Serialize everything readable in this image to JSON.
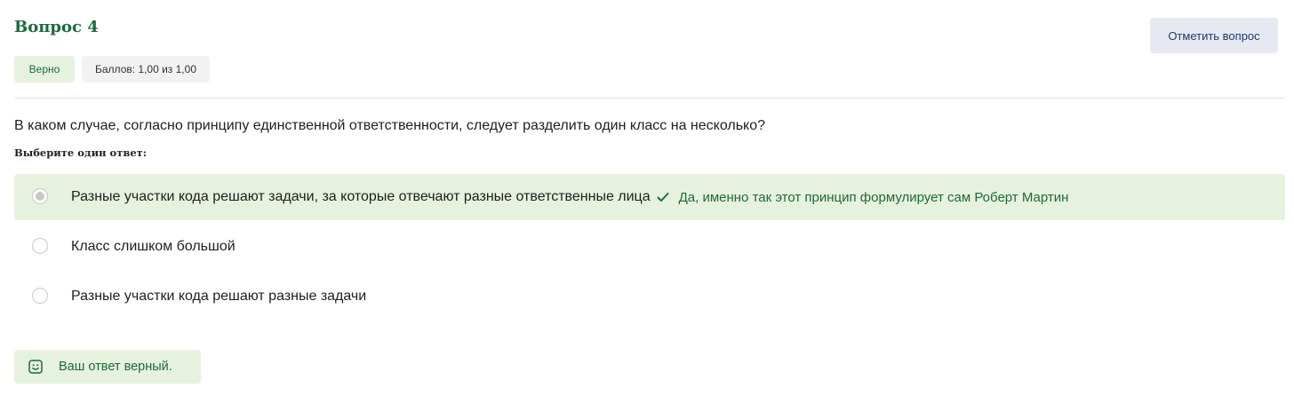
{
  "question": {
    "title": "Вопрос 4",
    "flag_label": "Отметить вопрос",
    "status_badge": "Верно",
    "score_badge": "Баллов: 1,00 из 1,00",
    "text": "В каком случае, согласно принципу единственной ответственности, следует разделить один класс на несколько?",
    "prompt": "Выберите один ответ:"
  },
  "options": [
    {
      "label": "Разные участки кода решают задачи, за которые отвечают разные ответственные лица",
      "selected": true,
      "feedback": "Да, именно так этот принцип формулирует сам Роберт Мартин"
    },
    {
      "label": "Класс слишком большой",
      "selected": false
    },
    {
      "label": "Разные участки кода решают разные задачи",
      "selected": false
    }
  ],
  "result": {
    "text": "Ваш ответ верный."
  },
  "colors": {
    "accent_green": "#1d6a3c",
    "correct_bg": "#e6f2dd",
    "flag_bg": "#e6e9f2"
  },
  "icons": {
    "check": "check-icon",
    "result": "smiley-icon"
  }
}
